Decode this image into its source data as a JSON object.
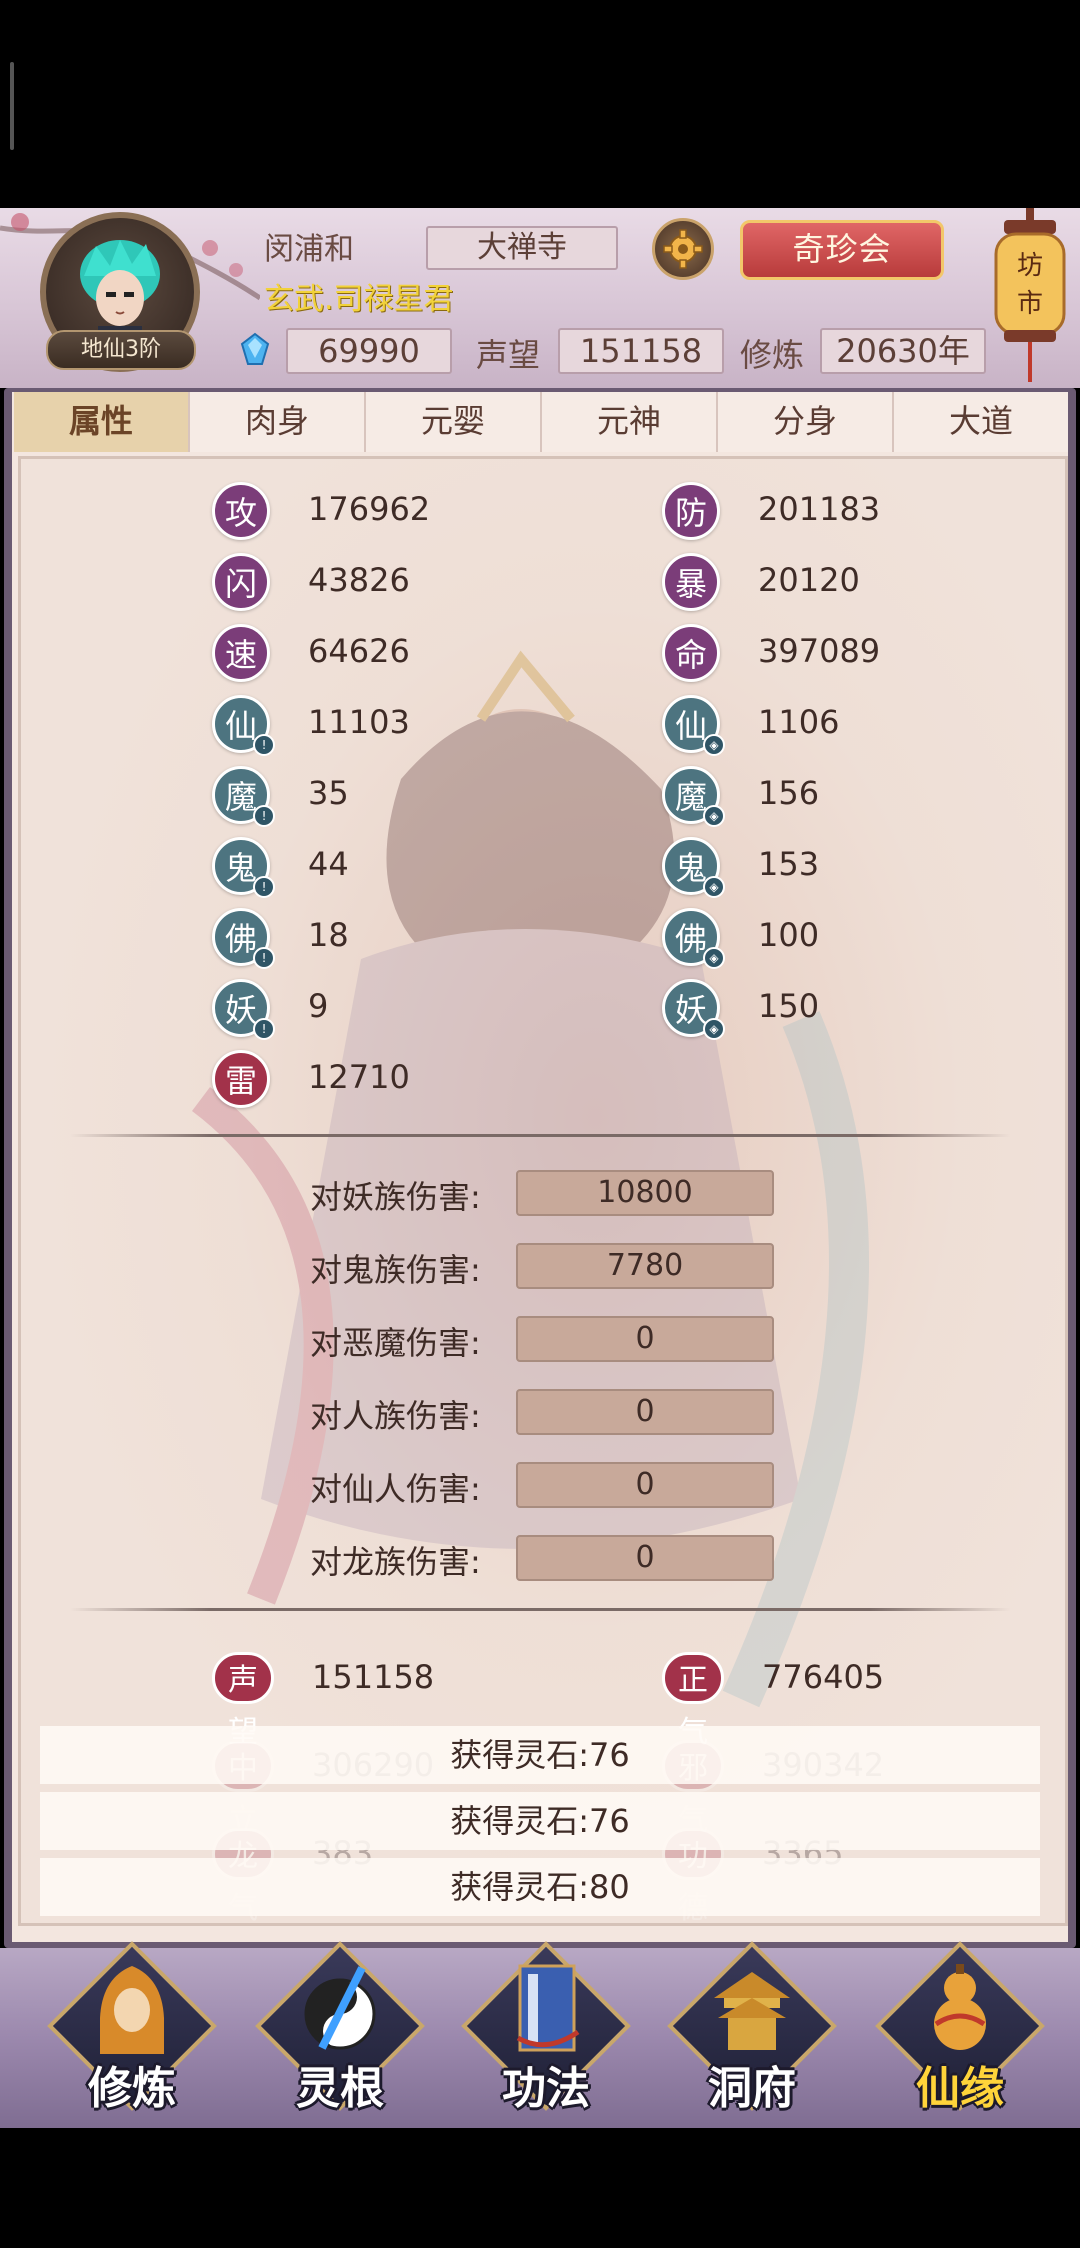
{
  "header": {
    "player_name": "闵浦和",
    "title": "玄武.司禄星君",
    "rank": "地仙3阶",
    "sect": "大禅寺",
    "market_button": "奇珍会",
    "lantern_text": "坊市",
    "resources": {
      "spirit_stones": "69990",
      "reputation_label": "声望",
      "reputation_value": "151158",
      "cultivation_label": "修炼",
      "cultivation_value": "20630年"
    }
  },
  "tabs": [
    "属性",
    "肉身",
    "元婴",
    "元神",
    "分身",
    "大道"
  ],
  "stats": {
    "left": [
      {
        "icon": "攻",
        "value": "176962"
      },
      {
        "icon": "闪",
        "value": "43826"
      },
      {
        "icon": "速",
        "value": "64626"
      },
      {
        "icon": "仙",
        "value": "11103"
      },
      {
        "icon": "魔",
        "value": "35"
      },
      {
        "icon": "鬼",
        "value": "44"
      },
      {
        "icon": "佛",
        "value": "18"
      },
      {
        "icon": "妖",
        "value": "9"
      },
      {
        "icon": "雷",
        "value": "12710"
      }
    ],
    "right": [
      {
        "icon": "防",
        "value": "201183"
      },
      {
        "icon": "暴",
        "value": "20120"
      },
      {
        "icon": "命",
        "value": "397089"
      },
      {
        "icon": "仙",
        "value": "1106"
      },
      {
        "icon": "魔",
        "value": "156"
      },
      {
        "icon": "鬼",
        "value": "153"
      },
      {
        "icon": "佛",
        "value": "100"
      },
      {
        "icon": "妖",
        "value": "150"
      }
    ]
  },
  "damage": [
    {
      "label": "对妖族伤害:",
      "value": "10800"
    },
    {
      "label": "对鬼族伤害:",
      "value": "7780"
    },
    {
      "label": "对恶魔伤害:",
      "value": "0"
    },
    {
      "label": "对人族伤害:",
      "value": "0"
    },
    {
      "label": "对仙人伤害:",
      "value": "0"
    },
    {
      "label": "对龙族伤害:",
      "value": "0"
    }
  ],
  "alignment": {
    "reputation": {
      "label": "声望",
      "value": "151158"
    },
    "righteous": {
      "label": "正气",
      "value": "776405"
    },
    "neutral": {
      "label": "中立",
      "value": "306290"
    },
    "evil": {
      "label": "邪气",
      "value": "390342"
    },
    "dragon": {
      "label": "龙气",
      "value": "383"
    },
    "merit": {
      "label": "功德",
      "value": "3365"
    }
  },
  "toasts": [
    "获得灵石:76",
    "获得灵石:76",
    "获得灵石:80"
  ],
  "nav": [
    {
      "label": "修炼",
      "icon": "cultivate-icon"
    },
    {
      "label": "灵根",
      "icon": "spirit-root-icon"
    },
    {
      "label": "功法",
      "icon": "technique-book-icon"
    },
    {
      "label": "洞府",
      "icon": "cave-dwelling-icon"
    },
    {
      "label": "仙缘",
      "icon": "immortal-fate-gourd-icon"
    }
  ],
  "colors": {
    "attack_badge": "#7b3d79",
    "element_badge": "#4d7480",
    "thunder_badge": "#a2324a",
    "market_button": "#c94848",
    "title_gold": "#f2d23a"
  }
}
